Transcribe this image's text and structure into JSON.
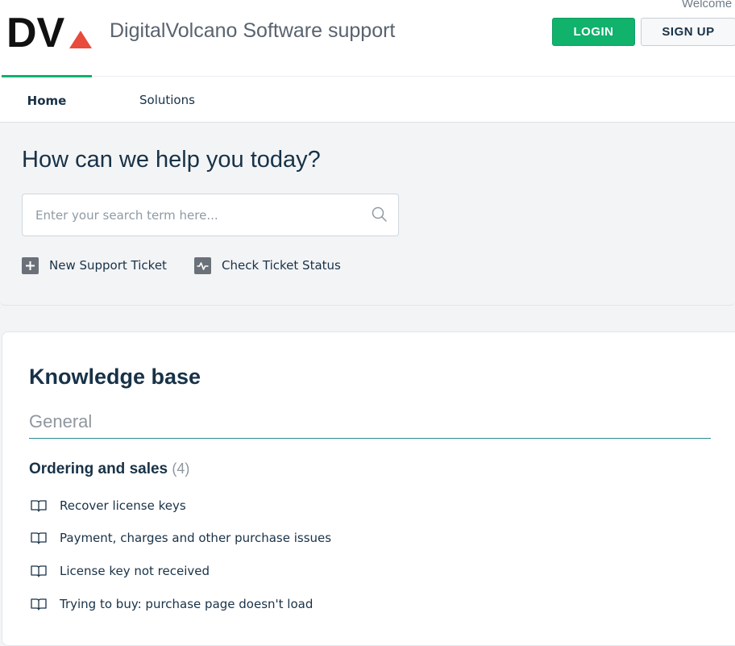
{
  "header": {
    "logo_text": "DV",
    "title": "DigitalVolcano Software support",
    "welcome": "Welcome",
    "login_label": "LOGIN",
    "signup_label": "SIGN UP"
  },
  "nav": {
    "tabs": [
      {
        "label": "Home",
        "active": true
      },
      {
        "label": "Solutions",
        "active": false
      }
    ]
  },
  "hero": {
    "title": "How can we help you today?",
    "search_placeholder": "Enter your search term here...",
    "actions": [
      {
        "label": "New Support Ticket",
        "icon": "plus-icon"
      },
      {
        "label": "Check Ticket Status",
        "icon": "activity-icon"
      }
    ]
  },
  "knowledge_base": {
    "title": "Knowledge base",
    "category": "General",
    "folder": {
      "name": "Ordering and sales",
      "count": "(4)",
      "articles": [
        "Recover license keys",
        "Payment, charges and other purchase issues",
        "License key not received",
        "Trying to buy: purchase page doesn't load"
      ]
    }
  },
  "colors": {
    "accent_green": "#10b26c",
    "text_dark": "#183247",
    "logo_red": "#e84a3c",
    "divider_teal": "#2b8c94"
  }
}
